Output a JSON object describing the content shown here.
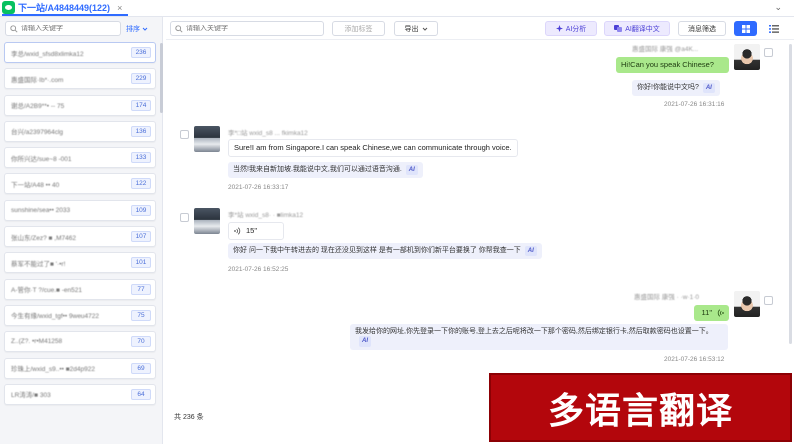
{
  "tab": {
    "title": "下一站/A4848449(122)",
    "close": "×",
    "chevron": "⌄"
  },
  "left": {
    "search_placeholder": "请输入关键字",
    "sort_label": "排序",
    "contacts": [
      {
        "name": "李总/wxid_sfsd8xlimka12",
        "count": "236"
      },
      {
        "name": "惠盛国际·Ib*·.com",
        "count": "229"
      },
      {
        "name": "谢总/A2B9**• -- 75",
        "count": "174"
      },
      {
        "name": "台兴/a2397964clg",
        "count": "136"
      },
      {
        "name": "你所兴达/sue~8 -001",
        "count": "133"
      },
      {
        "name": "下一站/A48 •• 40",
        "count": "122"
      },
      {
        "name": "sunshine/sea•• 2033",
        "count": "109"
      },
      {
        "name": "张山东/Zez? ■ ,M7462",
        "count": "107"
      },
      {
        "name": "蔡军不能过了■ '·•r!",
        "count": "101"
      },
      {
        "name": "A-管你·T ?/cue.■ -en521",
        "count": "77"
      },
      {
        "name": "今生有缘/wxid_tgf•• 9weu4722",
        "count": "75"
      },
      {
        "name": "Z..(Z?. •r•M41258",
        "count": "70"
      },
      {
        "name": "珍珠上/wxid_s9..•• ■2d4p922",
        "count": "69"
      },
      {
        "name": "LR涛涛/■ 303",
        "count": "64"
      }
    ]
  },
  "toolbar": {
    "search_placeholder": "请输入关键字",
    "filter_placeholder": "添加标签",
    "export_label": "导出",
    "ai_analyze_label": "AI分析",
    "ai_translate_label": "AI翻译中文",
    "msg_filter_label": "消息筛选"
  },
  "messages": {
    "m1": {
      "sender": "惠盛国际 康强 @a4K...",
      "text": "Hi!Can you speak Chinese?",
      "translation": "你好!你能说中文吗?",
      "time": "2021-07-26 16:31:16"
    },
    "m2": {
      "sender": "李*□站 wxid_s8 ... fkimka12",
      "text": "Sure!I am from Singapore.I can speak Chinese,we can communicate through voice.",
      "translation": "当然!我来自新加坡.我能说中文,我们可以通过语音沟通.",
      "time": "2021-07-26 16:33:17"
    },
    "m3": {
      "sender": "李*站 wxid_s8· · ■limka12",
      "voice_duration": "15\"",
      "translation": "你好 问一下我中午转进去的 现在还没见到这样 是有一部机到你们新平台要换了 你帮我查一下",
      "time": "2021-07-26 16:52:25"
    },
    "m4": {
      "sender": "惠盛国际 康强 · ·w·1·0",
      "voice_duration": "11\"",
      "translation": "我发给你的网址,你先登录一下你的账号,登上去之后呢将改一下那个密码,然后绑定银行卡,然后取款密码也设置一下。",
      "time": "2021-07-26 16:53:12"
    }
  },
  "ai_tag": "AI",
  "total_label": "共 236 条",
  "banner_text": "多语言翻译",
  "colors": {
    "accent": "#2f6bff",
    "bubble_green": "#a9e88b",
    "banner": "#b3060c"
  }
}
